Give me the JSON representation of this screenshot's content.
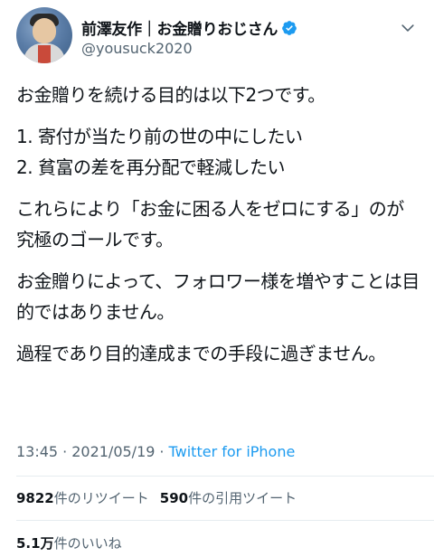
{
  "user": {
    "display_name": "前澤友作｜お金贈りおじさん",
    "handle": "@yousuck2020",
    "verified": true
  },
  "tweet": {
    "paragraphs": [
      "お金贈りを続ける目的は以下2つです。",
      "1. 寄付が当たり前の世の中にしたい\n2. 貧富の差を再分配で軽減したい",
      "これらにより「お金に困る人をゼロにする」のが究極のゴールです。",
      "お金贈りによって、フォロワー様を増やすことは目的ではありません。",
      "過程であり目的達成までの手段に過ぎません。"
    ]
  },
  "meta": {
    "time": "13:45",
    "separator": "·",
    "date": "2021/05/19",
    "source": "Twitter for iPhone"
  },
  "stats": {
    "retweets": {
      "count": "9822",
      "label": "件のリツイート"
    },
    "quotes": {
      "count": "590",
      "label": "件の引用ツイート"
    },
    "likes": {
      "count": "5.1万",
      "label": "件のいいね"
    }
  },
  "colors": {
    "text": "#0f1419",
    "secondary": "#536471",
    "accent": "#1d9bf0",
    "divider": "#e6ecf0"
  }
}
